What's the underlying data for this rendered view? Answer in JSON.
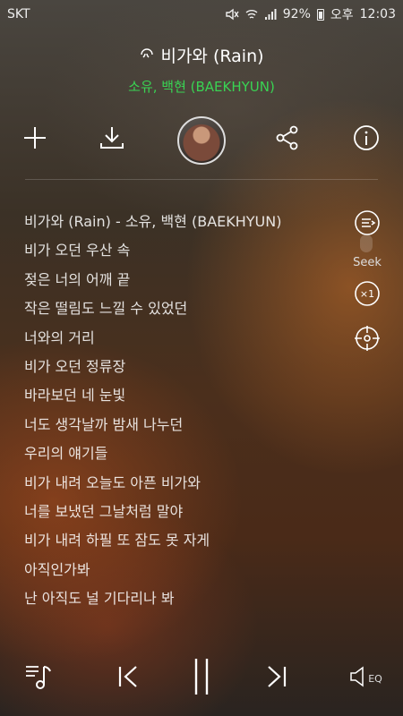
{
  "status_bar": {
    "carrier": "SKT",
    "battery": "92%",
    "ampm": "오후",
    "time": "12:03"
  },
  "song": {
    "title": "비가와 (Rain)",
    "artist": "소유, 백현 (BAEKHYUN)"
  },
  "actions": {
    "icons": [
      "plus-icon",
      "download-icon",
      "album-art",
      "share-icon",
      "info-icon"
    ]
  },
  "lyrics": [
    "비가와 (Rain) - 소유, 백현 (BAEKHYUN)",
    "비가 오던 우산 속",
    "젖은 너의 어깨 끝",
    "작은 떨림도 느낄 수 있었던",
    "너와의 거리",
    "비가 오던 정류장",
    "바라보던 네 눈빛",
    "너도 생각날까 밤새 나누던",
    "우리의 얘기들",
    "비가 내려 오늘도 아픈 비가와",
    "너를 보냈던 그날처럼 말야",
    "비가 내려 하필 또 잠도 못 자게",
    "아직인가봐",
    "난 아직도 널 기다리나 봐"
  ],
  "side_controls": {
    "seek_label": "Seek",
    "speed_label": "×1"
  },
  "bottom_controls": {
    "eq_label": "EQ"
  },
  "colors": {
    "artist_green": "#39d353"
  }
}
